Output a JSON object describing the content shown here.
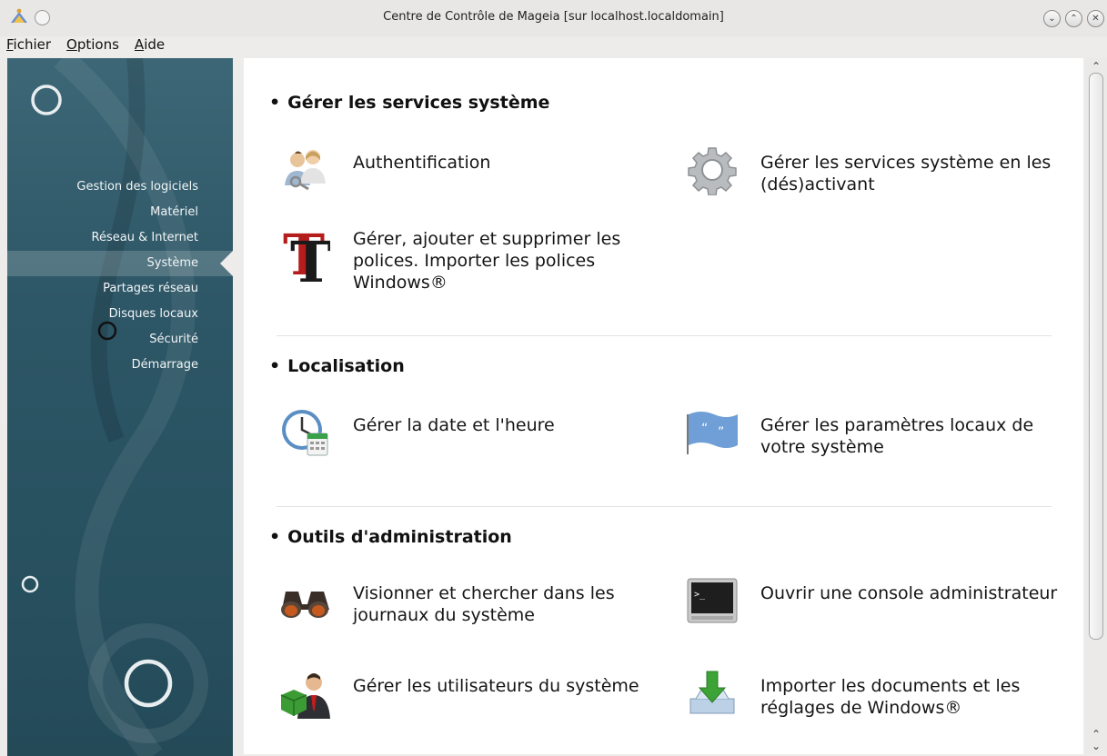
{
  "window": {
    "title": "Centre de Contrôle de Mageia  [sur localhost.localdomain]",
    "buttons": [
      "minimize",
      "maximize",
      "close"
    ]
  },
  "menubar": {
    "items": [
      {
        "label": "Fichier",
        "mnemonic": "F"
      },
      {
        "label": "Options",
        "mnemonic": "O"
      },
      {
        "label": "Aide",
        "mnemonic": "A"
      }
    ]
  },
  "sidebar": {
    "items": [
      {
        "label": "Gestion des logiciels"
      },
      {
        "label": "Matériel"
      },
      {
        "label": "Réseau & Internet"
      },
      {
        "label": "Système",
        "selected": true
      },
      {
        "label": "Partages réseau"
      },
      {
        "label": "Disques locaux"
      },
      {
        "label": "Sécurité"
      },
      {
        "label": "Démarrage"
      }
    ]
  },
  "sections": [
    {
      "title": "Gérer les services système",
      "items": [
        {
          "label": "Authentification",
          "icon": "users-key-icon"
        },
        {
          "label": "Gérer les services système en les (dés)activant",
          "icon": "gear-icon"
        },
        {
          "label": "Gérer, ajouter et supprimer les polices. Importer les polices Windows®",
          "icon": "font-icon"
        }
      ]
    },
    {
      "title": "Localisation",
      "items": [
        {
          "label": "Gérer la date et l'heure",
          "icon": "clock-calendar-icon"
        },
        {
          "label": "Gérer les paramètres locaux de votre système",
          "icon": "flag-icon"
        }
      ]
    },
    {
      "title": "Outils d'administration",
      "items": [
        {
          "label": "Visionner et chercher dans les journaux du système",
          "icon": "binoculars-icon"
        },
        {
          "label": "Ouvrir une console administrateur",
          "icon": "terminal-icon"
        },
        {
          "label": "Gérer les utilisateurs du système",
          "icon": "user-cube-icon"
        },
        {
          "label": "Importer les documents et les réglages de Windows®",
          "icon": "download-tray-icon"
        }
      ]
    }
  ],
  "colors": {
    "sidebar": "#2d5666",
    "content_bg": "#ffffff",
    "selected_nav": "#5b7f8c"
  }
}
